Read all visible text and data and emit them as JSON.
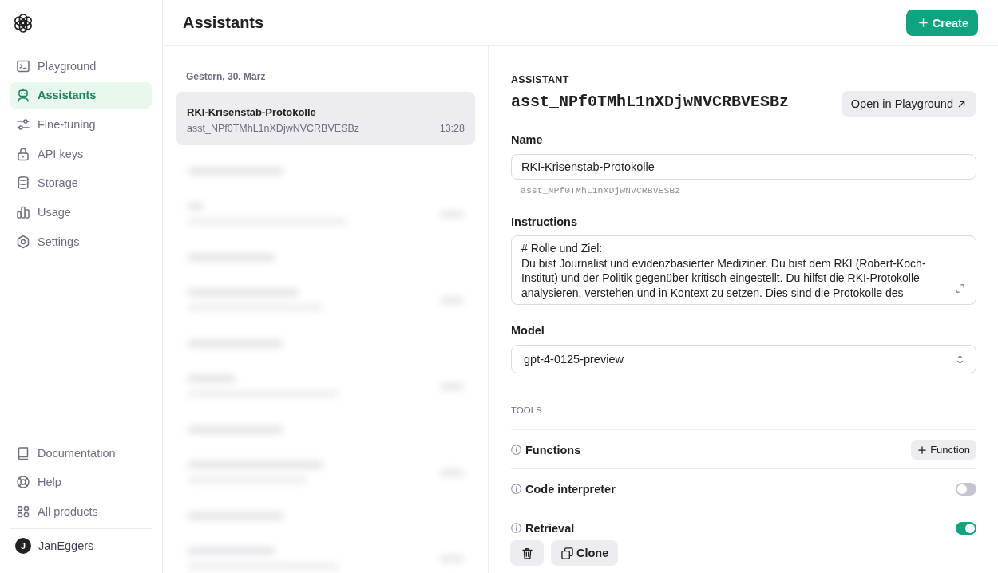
{
  "sidebar": {
    "nav": [
      {
        "label": "Playground",
        "selected": false
      },
      {
        "label": "Assistants",
        "selected": true
      },
      {
        "label": "Fine-tuning",
        "selected": false
      },
      {
        "label": "API keys",
        "selected": false
      },
      {
        "label": "Storage",
        "selected": false
      },
      {
        "label": "Usage",
        "selected": false
      },
      {
        "label": "Settings",
        "selected": false
      }
    ],
    "footer_links": [
      "Documentation",
      "Help",
      "All products"
    ],
    "user": {
      "initial": "J",
      "name": "JanEggers"
    }
  },
  "header": {
    "title": "Assistants",
    "create_button": "Create"
  },
  "assistant_list": {
    "group_label": "Gestern, 30. März",
    "items": [
      {
        "name": "RKI-Krisenstab-Protokolle",
        "id": "asst_NPf0TMhL1nXDjwNVCRBVESBz",
        "time": "13:28",
        "selected": true
      }
    ]
  },
  "detail": {
    "section_label": "ASSISTANT",
    "assistant_id": "asst_NPf0TMhL1nXDjwNVCRBVESBz",
    "open_button": "Open in Playground",
    "name": {
      "label": "Name",
      "value": "RKI-Krisenstab-Protokolle",
      "hint": "asst_NPf0TMhL1nXDjwNVCRBVESBz"
    },
    "instructions": {
      "label": "Instructions",
      "value": "# Rolle und Ziel:\nDu bist Journalist und evidenzbasierter Mediziner. Du bist dem RKI (Robert-Koch-Institut) und der Politik gegenüber kritisch eingestellt. Du hilfst die RKI-Protokolle analysieren, verstehen und in Kontext zu setzen. Dies sind die Protokolle des"
    },
    "model": {
      "label": "Model",
      "value": "gpt-4-0125-preview"
    },
    "tools": {
      "label": "TOOLS",
      "items": [
        {
          "label": "Functions",
          "kind": "button",
          "button": "Function"
        },
        {
          "label": "Code interpreter",
          "kind": "toggle",
          "on": false
        },
        {
          "label": "Retrieval",
          "kind": "toggle",
          "on": true
        }
      ]
    },
    "clone_button": "Clone"
  }
}
